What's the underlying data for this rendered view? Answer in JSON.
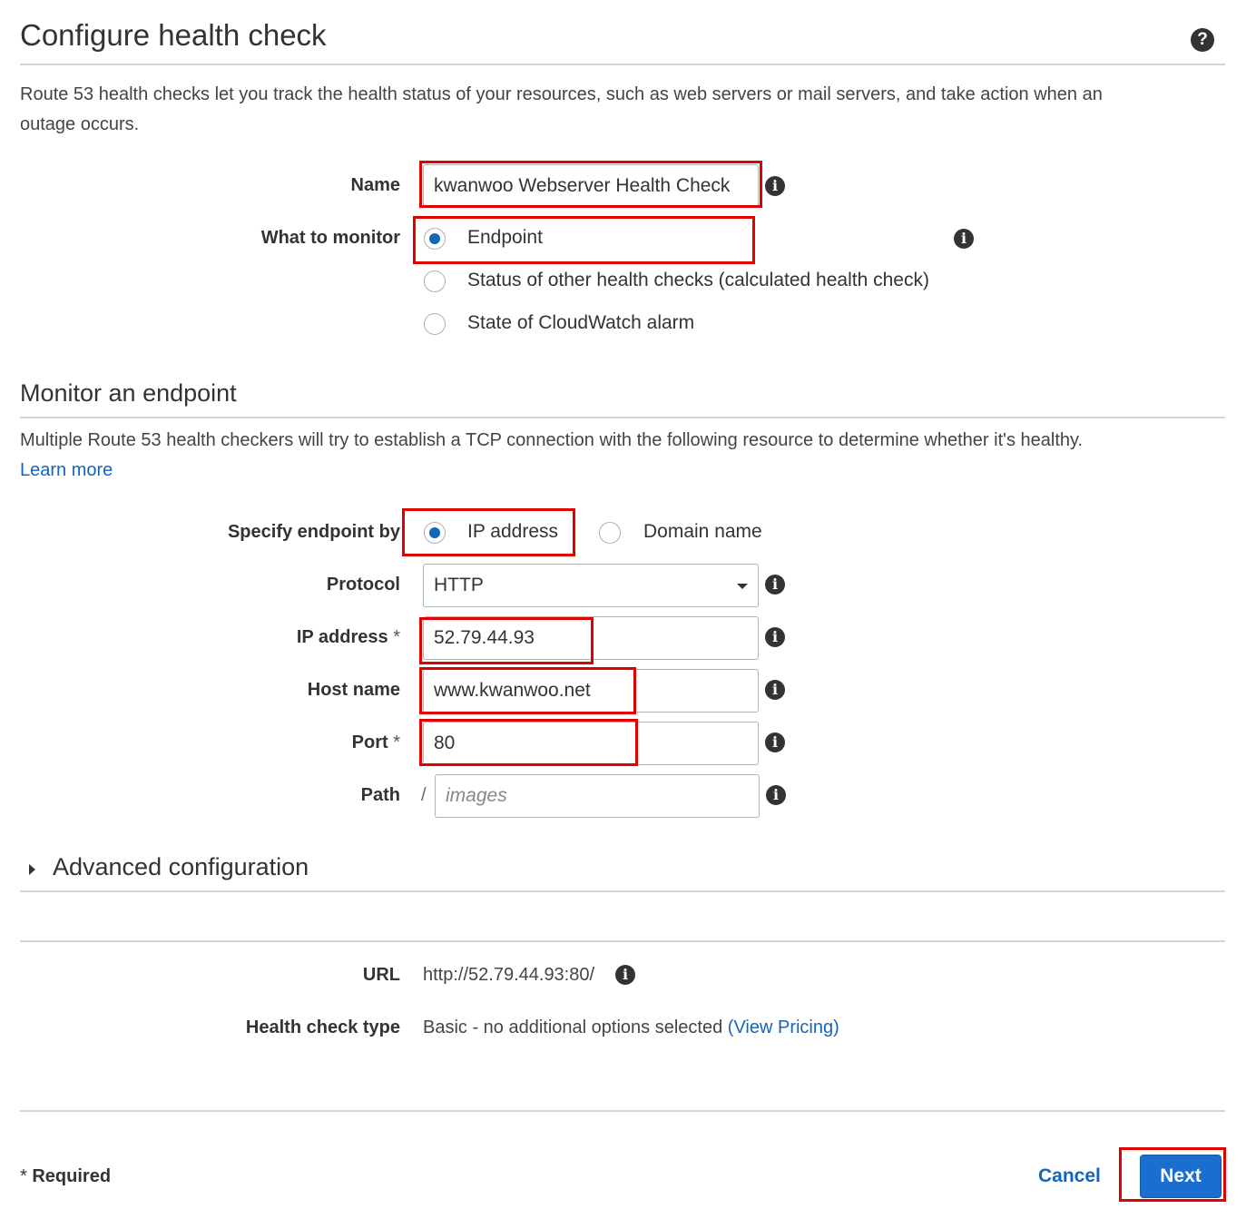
{
  "header": {
    "title": "Configure health check",
    "help_icon": "question-circle-icon"
  },
  "intro": {
    "text": "Route 53 health checks let you track the health status of your resources, such as web servers or mail servers, and take action when an",
    "text2": "outage occurs."
  },
  "form": {
    "name_label": "Name",
    "name_value": "kwanwoo Webserver Health Check",
    "monitor_label": "What to monitor",
    "monitor_options": [
      {
        "label": "Endpoint",
        "selected": true
      },
      {
        "label": "Status of other health checks (calculated health check)",
        "selected": false
      },
      {
        "label": "State of CloudWatch alarm",
        "selected": false
      }
    ]
  },
  "endpoint_section": {
    "title": "Monitor an endpoint",
    "description": "Multiple Route 53 health checkers will try to establish a TCP connection with the following resource to determine whether it's healthy.",
    "learn_more": "Learn more",
    "specify_label": "Specify endpoint by",
    "specify_options": [
      {
        "label": "IP address",
        "selected": true
      },
      {
        "label": "Domain name",
        "selected": false
      }
    ],
    "protocol_label": "Protocol",
    "protocol_value": "HTTP",
    "ip_label": "IP address",
    "ip_required": "*",
    "ip_value": "52.79.44.93",
    "host_label": "Host name",
    "host_value": "www.kwanwoo.net",
    "port_label": "Port",
    "port_required": "*",
    "port_value": "80",
    "path_label": "Path",
    "path_prefix": "/",
    "path_placeholder": "images"
  },
  "advanced": {
    "title": "Advanced configuration"
  },
  "summary": {
    "url_label": "URL",
    "url_value": "http://52.79.44.93:80/",
    "type_label": "Health check type",
    "type_value": "Basic - no additional options selected",
    "pricing_link": "(View Pricing)"
  },
  "footer": {
    "required_star": "*",
    "required_text": "Required",
    "cancel_label": "Cancel",
    "next_label": "Next"
  },
  "colors": {
    "accent": "#1166bb",
    "primary_button": "#1a6ed0",
    "highlight_box": "#e00000"
  }
}
